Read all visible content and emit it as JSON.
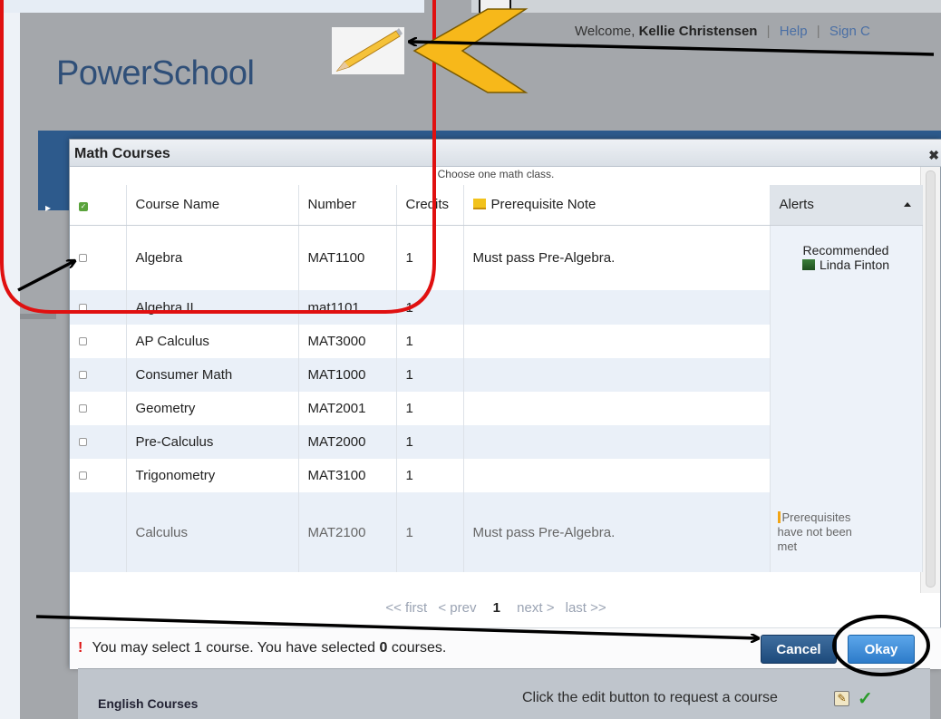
{
  "app": {
    "logo": "PowerSchool",
    "welcome_prefix": "Welcome,",
    "user_name": "Kellie Christensen",
    "help_link": "Help",
    "sign_out_link": "Sign C"
  },
  "modal": {
    "title": "Math Courses",
    "subtitle": "Choose one math class.",
    "columns": {
      "course_name": "Course Name",
      "number": "Number",
      "credits": "Credits",
      "prerequisite_note": "Prerequisite Note",
      "alerts": "Alerts"
    },
    "rows": [
      {
        "name": "Algebra",
        "number": "MAT1100",
        "credits": "1",
        "note": "Must pass Pre-Algebra.",
        "alert_line1": "Recommended",
        "alert_line2": "Linda Finton"
      },
      {
        "name": "Algebra II",
        "number": "mat1101",
        "credits": "1",
        "note": ""
      },
      {
        "name": "AP Calculus",
        "number": "MAT3000",
        "credits": "1",
        "note": ""
      },
      {
        "name": "Consumer Math",
        "number": "MAT1000",
        "credits": "1",
        "note": ""
      },
      {
        "name": "Geometry",
        "number": "MAT2001",
        "credits": "1",
        "note": ""
      },
      {
        "name": "Pre-Calculus",
        "number": "MAT2000",
        "credits": "1",
        "note": ""
      },
      {
        "name": "Trigonometry",
        "number": "MAT3100",
        "credits": "1",
        "note": ""
      },
      {
        "name": "Calculus",
        "number": "MAT2100",
        "credits": "1",
        "note": "Must pass Pre-Algebra.",
        "alert_line1": "Prerequisites",
        "alert_line2": "have not been",
        "alert_line3": "met"
      }
    ],
    "pager": {
      "first": "<< first",
      "prev": "< prev",
      "current": "1",
      "next": "next >",
      "last": "last >>"
    },
    "footer": {
      "excl": "!",
      "msg_prefix": "You may select 1 course. You have selected",
      "count": "0",
      "msg_suffix": "courses.",
      "cancel": "Cancel",
      "okay": "Okay"
    }
  },
  "english": {
    "title": "English Courses",
    "hint": "Click the edit button to request a course"
  },
  "colors": {
    "annotation_red": "#e01010",
    "arrow_yellow": "#f7b81a",
    "header_blue": "#2d5a8c"
  }
}
